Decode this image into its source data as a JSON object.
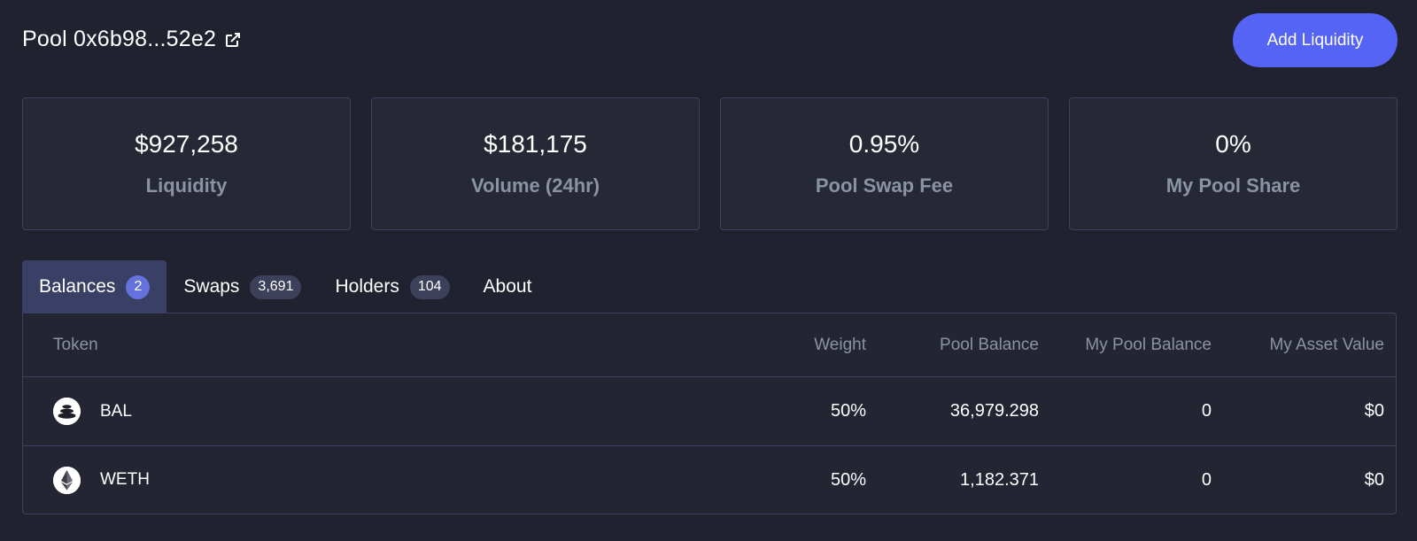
{
  "header": {
    "title": "Pool 0x6b98...52e2",
    "external_link_icon": "external-link-icon",
    "add_liquidity_label": "Add Liquidity",
    "accent_color": "#5664f5"
  },
  "stats": [
    {
      "value": "$927,258",
      "label": "Liquidity"
    },
    {
      "value": "$181,175",
      "label": "Volume (24hr)"
    },
    {
      "value": "0.95%",
      "label": "Pool Swap Fee"
    },
    {
      "value": "0%",
      "label": "My Pool Share"
    }
  ],
  "tabs": [
    {
      "label": "Balances",
      "count": "2",
      "active": true
    },
    {
      "label": "Swaps",
      "count": "3,691",
      "active": false
    },
    {
      "label": "Holders",
      "count": "104",
      "active": false
    },
    {
      "label": "About",
      "count": null,
      "active": false
    }
  ],
  "table": {
    "columns": [
      "Token",
      "Weight",
      "Pool Balance",
      "My Pool Balance",
      "My Asset Value"
    ],
    "rows": [
      {
        "icon": "bal-token-icon",
        "token": "BAL",
        "weight": "50%",
        "pool_balance": "36,979.298",
        "my_pool_balance": "0",
        "my_asset_value": "$0"
      },
      {
        "icon": "eth-token-icon",
        "token": "WETH",
        "weight": "50%",
        "pool_balance": "1,182.371",
        "my_pool_balance": "0",
        "my_asset_value": "$0"
      }
    ]
  }
}
